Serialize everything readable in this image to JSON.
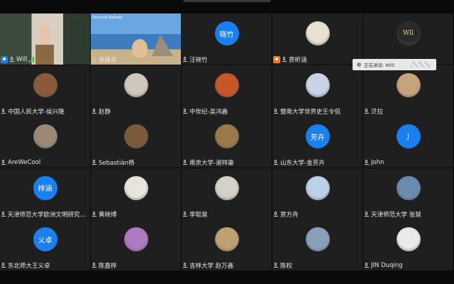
{
  "speaking": {
    "label": "正在讲话: Will;"
  },
  "tiles": [
    {
      "name": "Will",
      "kind": "video1",
      "badge": "user",
      "signal": true,
      "active": true
    },
    {
      "name": "张建华",
      "kind": "video2",
      "caption": "Ostrovok Baikala"
    },
    {
      "name": "汪晓竹",
      "kind": "text",
      "avatar_text": "晓竹",
      "color": "#1a7ff0"
    },
    {
      "name": "贾昕涵",
      "kind": "img",
      "badge": "host",
      "bg": "#e8e0d0"
    },
    {
      "name": "",
      "kind": "img",
      "bg": "#2a2a2a",
      "avatar_text": "Wll"
    },
    {
      "name": "中国人民大学-侯兴隆",
      "kind": "img",
      "bg": "#8a5a3a"
    },
    {
      "name": "赵静",
      "kind": "img",
      "bg": "#cfc7bb"
    },
    {
      "name": "中世纪-吴鸿鑫",
      "kind": "img",
      "bg": "#c8562a"
    },
    {
      "name": "暨南大学世界史王令侃",
      "kind": "img",
      "bg": "#c9d2e6"
    },
    {
      "name": "贝拉",
      "kind": "img",
      "bg": "#c6a37a"
    },
    {
      "name": "AreWeCool",
      "kind": "img",
      "bg": "#9a8a75"
    },
    {
      "name": "Sebastián杨",
      "kind": "img",
      "bg": "#7a5a3a"
    },
    {
      "name": "南京大学-谢祥康",
      "kind": "img",
      "bg": "#9a7a4a"
    },
    {
      "name": "山东大学-金芳卉",
      "kind": "text",
      "avatar_text": "芳卉",
      "color": "#1a7ff0"
    },
    {
      "name": "John",
      "kind": "text",
      "avatar_text": "J",
      "color": "#1a7ff0"
    },
    {
      "name": "天津师范大学欧洲文明研究院-...",
      "kind": "text",
      "avatar_text": "梓涵",
      "color": "#1a7ff0"
    },
    {
      "name": "黄晓博",
      "kind": "img",
      "bg": "#e8e4dc"
    },
    {
      "name": "李聪慧",
      "kind": "img",
      "bg": "#d6d0c8"
    },
    {
      "name": "贾方舟",
      "kind": "img",
      "bg": "#bcd0ea"
    },
    {
      "name": "天津师范大学 张慧",
      "kind": "img",
      "bg": "#6a8ab0"
    },
    {
      "name": "东北师大王义卓",
      "kind": "text",
      "avatar_text": "义卓",
      "color": "#1a7ff0"
    },
    {
      "name": "陈嘉梓",
      "kind": "img",
      "bg": "#b07ac0"
    },
    {
      "name": "吉林大学 赵万鑫",
      "kind": "img",
      "bg": "#c0a070"
    },
    {
      "name": "陈权",
      "kind": "img",
      "bg": "#8aa0b8"
    },
    {
      "name": "JIN Duqing",
      "kind": "img",
      "bg": "#ece8ea"
    }
  ]
}
